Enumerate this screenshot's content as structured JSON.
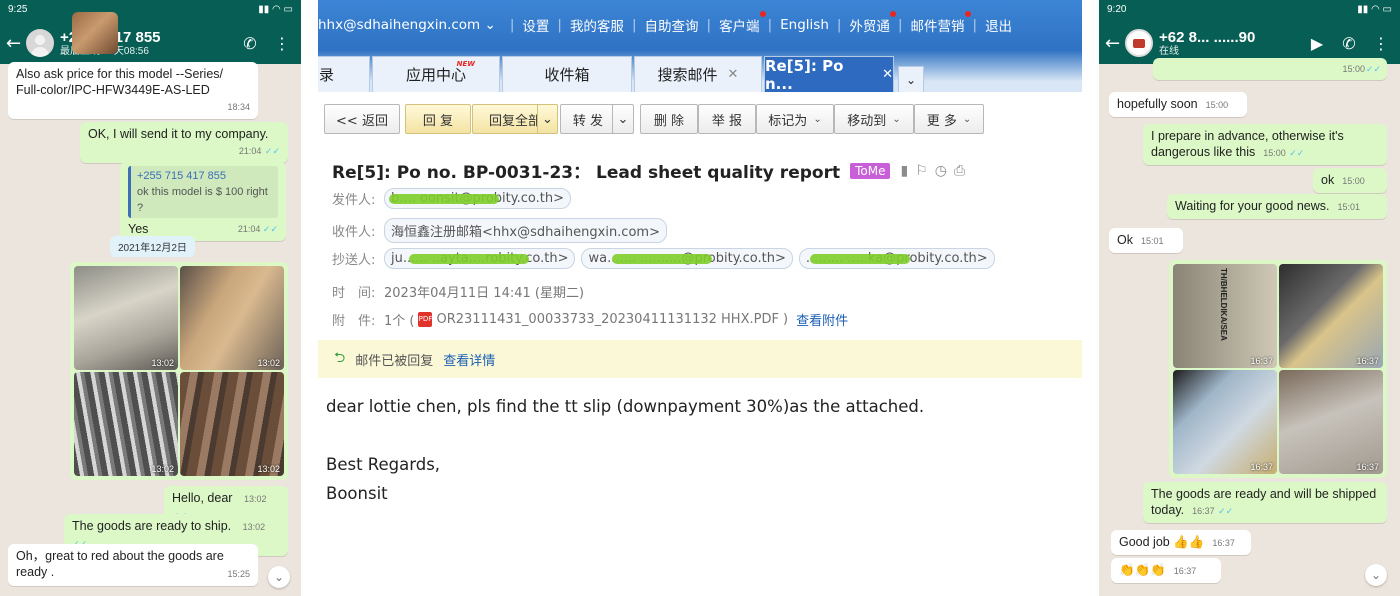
{
  "left_phone": {
    "status": {
      "time": "9:25",
      "icons": "▪ ⏰ ◙"
    },
    "contact": {
      "name": "+25 ... 417 855",
      "last_seen": "最后上线 ... 天08:56"
    },
    "messages": [
      {
        "text": "Also ask price for this model --Series/ Full-color/IPC-HFW3449E-AS-LED",
        "time": "18:34"
      },
      {
        "text": "OK, I will send it to my company.",
        "time": "21:04"
      },
      {
        "quote_name": "+255 715 417 855",
        "quote_text": "ok this model is $ 100 right ?",
        "text": "Yes",
        "time": "21:04"
      },
      {
        "text": "Hello, dear",
        "time": "13:02"
      },
      {
        "text": "The goods are ready to ship.",
        "time": "13:02"
      },
      {
        "text": "Oh，great to red about the goods are ready  .",
        "time": "15:25"
      }
    ],
    "date_pill": "2021年12月2日",
    "photo_times": [
      "13:02",
      "13:02",
      "13:02",
      "13:02"
    ]
  },
  "mail": {
    "account": "hhx@sdhaihengxin.com",
    "nav": [
      "设置",
      "我的客服",
      "自助查询",
      "客户端",
      "English",
      "外贸通",
      "邮件营销",
      "退出"
    ],
    "tabs": [
      "录",
      "应用中心",
      "收件箱",
      "搜索邮件",
      "Re[5]: Po n..."
    ],
    "tab_badge": "NEW",
    "toolbar": {
      "back": "<< 返回",
      "reply": "回 复",
      "reply_all": "回复全部",
      "forward": "转 发",
      "delete": "删 除",
      "report": "举 报",
      "mark": "标记为",
      "move": "移动到",
      "more": "更 多"
    },
    "subject": "Re[5]: Po no. BP-0031-23： Lead sheet quality report",
    "tome": "ToMe",
    "from_label": "发件人:",
    "from": "b.... oonsit@probity.co.th>",
    "to_label": "收件人:",
    "to": "海恒鑫注册邮箱<hhx@sdhaihengxin.com>",
    "cc_label": "抄送人:",
    "cc": [
      "ju...... ..ayta....robity.co.th>",
      "wa....... ..........@probity.co.th>",
      "......... .....ka@probity.co.th>"
    ],
    "time_label": "时　间:",
    "time": "2023年04月11日 14:41 (星期二)",
    "attach_label": "附　件:",
    "attach_count": "1个 (",
    "attach_file": "OR23111431_00033733_20230411131132 HHX.PDF )",
    "attach_link": "查看附件",
    "replied_text": "邮件已被回复",
    "replied_link": "查看详情",
    "body": [
      "dear lottie chen, pls find the tt slip (downpayment 30%)as the attached.",
      "",
      "Best Regards,",
      "Boonsit"
    ]
  },
  "right_phone": {
    "status": {
      "time": "9:20",
      "icons": "◙ ⏰ ◙"
    },
    "contact": {
      "name": "+62 8... ......90",
      "status": "在线"
    },
    "messages": [
      {
        "text": "",
        "time": "15:00"
      },
      {
        "text": "hopefully soon",
        "time": "15:00"
      },
      {
        "text": "I prepare in advance, otherwise it's dangerous like this",
        "time": "15:00"
      },
      {
        "text": "ok",
        "time": "15:00"
      },
      {
        "text": "Waiting for your good news.",
        "time": "15:01"
      },
      {
        "text": "Ok",
        "time": "15:01"
      },
      {
        "text": "The goods are ready and will be shipped today.",
        "time": "16:37"
      },
      {
        "text": "Good job 👍👍",
        "time": "16:37"
      },
      {
        "text": "👏👏👏",
        "time": "16:37"
      }
    ],
    "photo_times": [
      "16:37",
      "16:37",
      "16:37",
      "16:37"
    ],
    "photo_label": "TH/BHELDIKA/SEA"
  }
}
